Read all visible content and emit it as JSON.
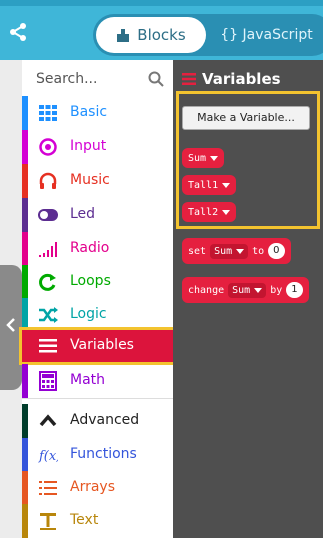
{
  "header": {
    "tabs": [
      {
        "label": "Blocks",
        "selected": true
      },
      {
        "label": "{} JavaScript",
        "selected": false
      }
    ]
  },
  "palette": {
    "search_placeholder": "Search...",
    "categories": [
      {
        "label": "Basic",
        "color": "#1e90ff",
        "icon": "grid-icon"
      },
      {
        "label": "Input",
        "color": "#d400d4",
        "icon": "target-icon"
      },
      {
        "label": "Music",
        "color": "#e63022",
        "icon": "headphones-icon"
      },
      {
        "label": "Led",
        "color": "#5c2d91",
        "icon": "toggle-icon"
      },
      {
        "label": "Radio",
        "color": "#e3008c",
        "icon": "signal-icon"
      },
      {
        "label": "Loops",
        "color": "#00aa00",
        "icon": "loop-icon"
      },
      {
        "label": "Logic",
        "color": "#00a4a6",
        "icon": "shuffle-icon"
      },
      {
        "label": "Variables",
        "color": "#dc143c",
        "icon": "lines-icon",
        "selected": true
      },
      {
        "label": "Math",
        "color": "#9400d3",
        "icon": "calculator-icon"
      },
      {
        "label": "Advanced",
        "color": "#003d2b",
        "icon": "chevron-up-icon"
      },
      {
        "label": "Functions",
        "color": "#3455db",
        "icon": "function-icon"
      },
      {
        "label": "Arrays",
        "color": "#e65722",
        "icon": "list-icon"
      },
      {
        "label": "Text",
        "color": "#b8860b",
        "icon": "text-icon"
      }
    ]
  },
  "flyout": {
    "title": "Variables",
    "make_variable_label": "Make a Variable...",
    "variables": [
      "Sum",
      "Tall1",
      "Tall2"
    ],
    "set_block": {
      "keyword": "set",
      "variable": "Sum",
      "to": "to",
      "value": "0"
    },
    "change_block": {
      "keyword": "change",
      "variable": "Sum",
      "by": "by",
      "value": "1"
    }
  }
}
